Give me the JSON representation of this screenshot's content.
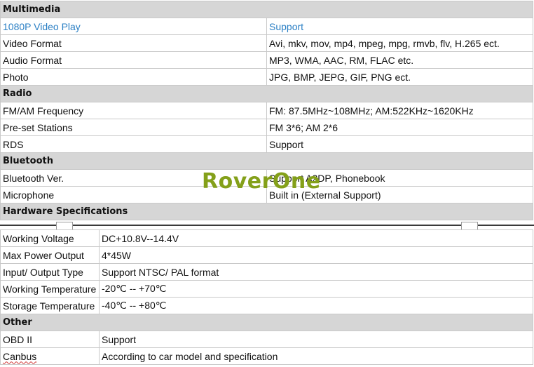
{
  "sections_top": [
    {
      "title": "Multimedia",
      "rows": [
        {
          "label": "1080P Video Play",
          "value": "Support",
          "highlight": true
        },
        {
          "label": "Video Format",
          "value": "Avi, mkv, mov, mp4, mpeg, mpg, rmvb, flv, H.265 ect."
        },
        {
          "label": "Audio Format",
          "value": "MP3, WMA, AAC, RM, FLAC etc."
        },
        {
          "label": "Photo",
          "value": "JPG, BMP, JEPG, GIF, PNG ect."
        }
      ]
    },
    {
      "title": "Radio",
      "rows": [
        {
          "label": "FM/AM Frequency",
          "value": "FM: 87.5MHz~108MHz; AM:522KHz~1620KHz"
        },
        {
          "label": "Pre-set Stations",
          "value": "FM 3*6; AM 2*6"
        },
        {
          "label": "RDS",
          "value": "Support"
        }
      ]
    },
    {
      "title": "Bluetooth",
      "rows": [
        {
          "label": "Bluetooth Ver.",
          "value": "Support A2DP, Phonebook"
        },
        {
          "label": "Microphone",
          "value": "Built in (External Support)"
        }
      ]
    },
    {
      "title": "Hardware Specifications",
      "rows": []
    }
  ],
  "sections_bottom": [
    {
      "title": "",
      "rows": [
        {
          "label": "Working Voltage",
          "value": "DC+10.8V--14.4V"
        },
        {
          "label": "Max Power Output",
          "value": "4*45W"
        },
        {
          "label": "Input/ Output Type",
          "value": "Support NTSC/ PAL format"
        },
        {
          "label": "Working Temperature",
          "value": "-20℃ -- +70℃"
        },
        {
          "label": "Storage Temperature",
          "value": "-40℃ -- +80℃"
        }
      ]
    },
    {
      "title": "Other",
      "rows": [
        {
          "label": "OBD II",
          "value": "Support"
        },
        {
          "label": "Canbus",
          "value": "According to car model and specification"
        }
      ]
    }
  ],
  "watermark": "RoverOne",
  "colors": {
    "header_bg": "#d6d6d6",
    "highlight_text": "#2a7fc4",
    "watermark": "#84a01a",
    "border": "#c9c9c9"
  }
}
